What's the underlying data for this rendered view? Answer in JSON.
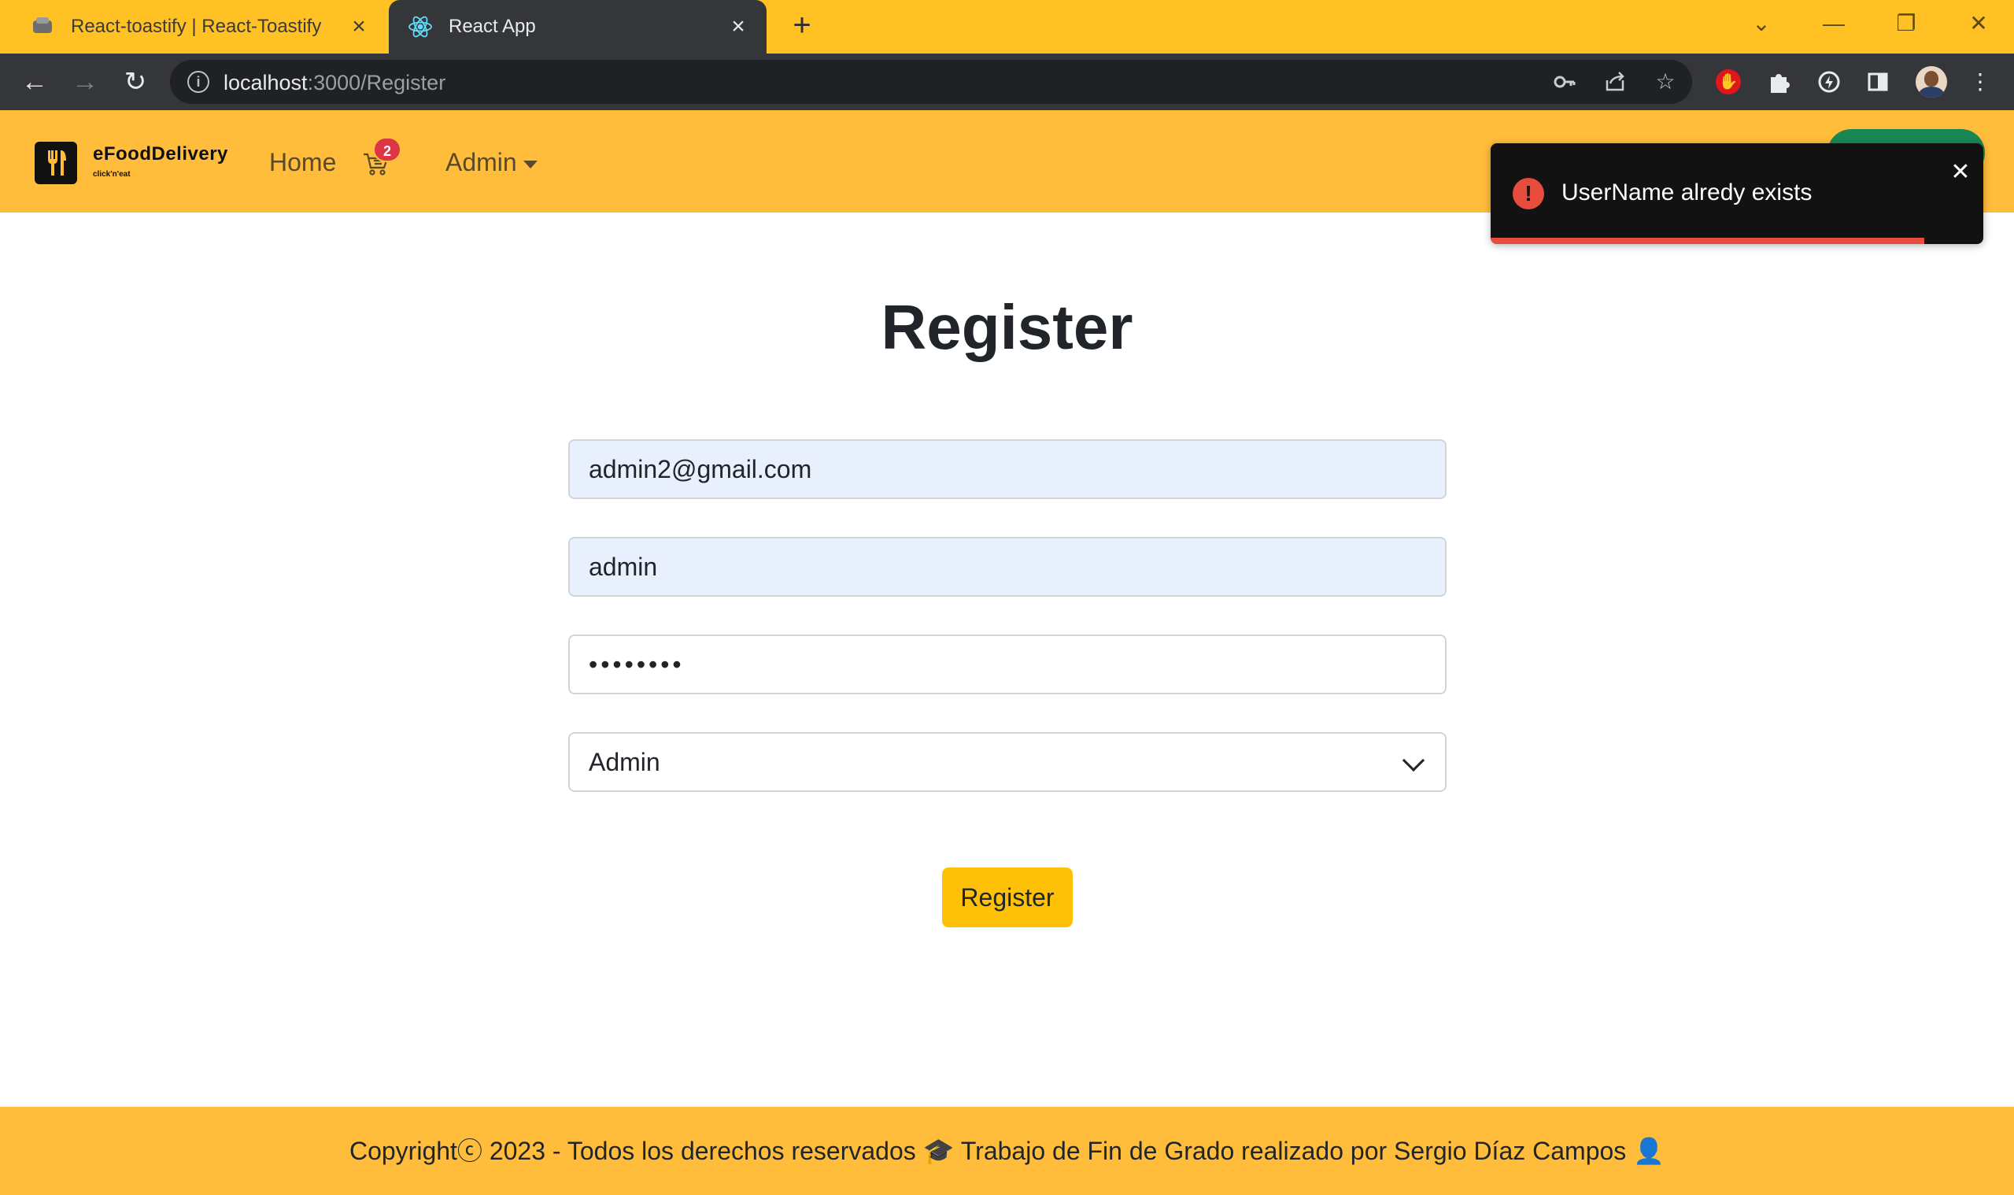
{
  "browser": {
    "tabs": [
      {
        "title": "React-toastify | React-Toastify",
        "active": false
      },
      {
        "title": "React App",
        "active": true
      }
    ],
    "new_tab_glyph": "+",
    "url_host": "localhost",
    "url_rest": ":3000/Register"
  },
  "navbar": {
    "brand": "eFoodDelivery",
    "brand_tagline": "click'n'eat",
    "home_link": "Home",
    "cart_count": "2",
    "admin_menu": "Admin"
  },
  "toast": {
    "message": "UserName alredy exists",
    "type": "error",
    "progress": 0.88,
    "accent_color": "#e74c3c"
  },
  "form": {
    "title": "Register",
    "email_value": "admin2@gmail.com",
    "username_value": "admin",
    "password_mask": "••••••••",
    "role_selected": "Admin",
    "submit_label": "Register"
  },
  "footer": {
    "text": "Copyrightⓒ 2023 - Todos los derechos reservados 🎓 Trabajo de Fin de Grado realizado por Sergio Díaz Campos 👤"
  },
  "colors": {
    "brand_yellow": "#ffbd3b",
    "button_yellow": "#ffc107",
    "tab_bar": "#ffc124",
    "chrome_dark": "#35363a"
  }
}
